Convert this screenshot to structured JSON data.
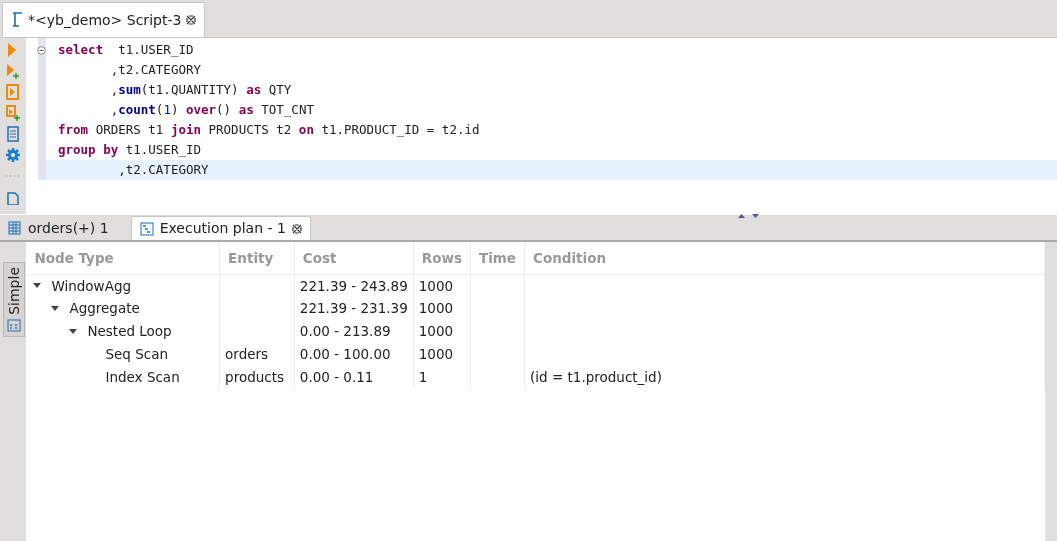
{
  "editor_tab": {
    "title": "*<yb_demo> Script-3",
    "selected": true
  },
  "code_lines": [
    {
      "current": false,
      "tokens": [
        {
          "kind": "kw",
          "text": "select"
        },
        {
          "kind": "plain",
          "text": "  t1.USER_ID"
        }
      ]
    },
    {
      "current": false,
      "tokens": [
        {
          "kind": "plain",
          "text": "       ,t2.CATEGORY"
        }
      ]
    },
    {
      "current": false,
      "tokens": [
        {
          "kind": "plain",
          "text": "       ,"
        },
        {
          "kind": "fn",
          "text": "sum"
        },
        {
          "kind": "plain",
          "text": "(t1.QUANTITY) "
        },
        {
          "kind": "kw",
          "text": "as"
        },
        {
          "kind": "plain",
          "text": " QTY"
        }
      ]
    },
    {
      "current": false,
      "tokens": [
        {
          "kind": "plain",
          "text": "       ,"
        },
        {
          "kind": "fn",
          "text": "count"
        },
        {
          "kind": "plain",
          "text": "("
        },
        {
          "kind": "num",
          "text": "1"
        },
        {
          "kind": "plain",
          "text": ") "
        },
        {
          "kind": "kw",
          "text": "over"
        },
        {
          "kind": "plain",
          "text": "() "
        },
        {
          "kind": "kw",
          "text": "as"
        },
        {
          "kind": "plain",
          "text": " TOT_CNT"
        }
      ]
    },
    {
      "current": false,
      "tokens": [
        {
          "kind": "kw",
          "text": "from"
        },
        {
          "kind": "plain",
          "text": " ORDERS t1 "
        },
        {
          "kind": "kw",
          "text": "join"
        },
        {
          "kind": "plain",
          "text": " PRODUCTS t2 "
        },
        {
          "kind": "kw",
          "text": "on"
        },
        {
          "kind": "plain",
          "text": " t1.PRODUCT_ID = t2.id"
        }
      ]
    },
    {
      "current": false,
      "tokens": [
        {
          "kind": "kw",
          "text": "group by"
        },
        {
          "kind": "plain",
          "text": " t1.USER_ID"
        }
      ]
    },
    {
      "current": true,
      "tokens": [
        {
          "kind": "plain",
          "text": "        ,t2.CATEGORY"
        }
      ]
    }
  ],
  "result_tabs": [
    {
      "label": "orders(+) 1",
      "kind": "grid",
      "selected": false
    },
    {
      "label": "Execution plan - 1",
      "kind": "plan",
      "selected": true
    }
  ],
  "side_tab": {
    "label": "Simple"
  },
  "plan": {
    "columns": [
      "Node Type",
      "Entity",
      "Cost",
      "Rows",
      "Time",
      "Condition"
    ],
    "rows": [
      {
        "node_type": "WindowAgg",
        "cost": "221.39 - 243.89",
        "rows": "1000",
        "expanded": true,
        "children": [
          {
            "node_type": "Aggregate",
            "cost": "221.39 - 231.39",
            "rows": "1000",
            "expanded": true,
            "children": [
              {
                "node_type": "Nested Loop",
                "cost": "0.00 - 213.89",
                "rows": "1000",
                "expanded": true,
                "children": [
                  {
                    "node_type": "Seq Scan",
                    "entity": "orders",
                    "cost": "0.00 - 100.00",
                    "rows": "1000"
                  },
                  {
                    "node_type": "Index Scan",
                    "entity": "products",
                    "cost": "0.00 - 0.11",
                    "rows": "1",
                    "condition": "(id = t1.product_id)"
                  }
                ]
              }
            ]
          }
        ]
      }
    ]
  }
}
